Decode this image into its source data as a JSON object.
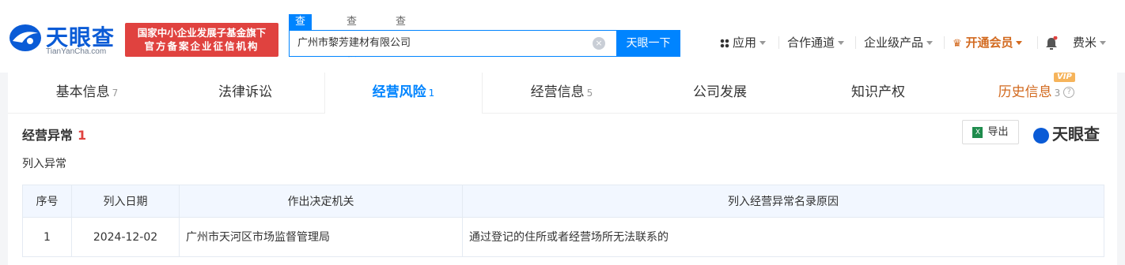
{
  "header": {
    "logo_text": "天眼查",
    "logo_sub": "TianYanCha.com",
    "badge_line1": "国家中小企业发展子基金旗下",
    "badge_line2": "官方备案企业征信机构",
    "search_tabs": [
      "查公司",
      "查老板",
      "查关系"
    ],
    "search_value": "广州市黎芳建材有限公司",
    "search_button": "天眼一下",
    "nav": {
      "apps": "应用",
      "partners": "合作通道",
      "enterprise": "企业级产品",
      "vip": "开通会员",
      "user": "费米"
    }
  },
  "tabs": [
    {
      "label": "基本信息",
      "count": "7"
    },
    {
      "label": "法律诉讼",
      "count": ""
    },
    {
      "label": "经营风险",
      "count": "1"
    },
    {
      "label": "经营信息",
      "count": "5"
    },
    {
      "label": "公司发展",
      "count": ""
    },
    {
      "label": "知识产权",
      "count": ""
    },
    {
      "label": "历史信息",
      "count": "3",
      "badge": "VIP"
    }
  ],
  "section": {
    "title": "经营异常",
    "count": "1",
    "export_label": "导出",
    "brand": "天眼查",
    "subhead": "列入异常"
  },
  "table": {
    "headers": [
      "序号",
      "列入日期",
      "作出决定机关",
      "列入经营异常名录原因"
    ],
    "rows": [
      [
        "1",
        "2024-12-02",
        "广州市天河区市场监督管理局",
        "通过登记的住所或者经营场所无法联系的"
      ]
    ]
  },
  "colors": {
    "accent": "#0084ff",
    "brand": "#0a5bd6",
    "alert": "#e0423f",
    "vip": "#d2691e"
  }
}
